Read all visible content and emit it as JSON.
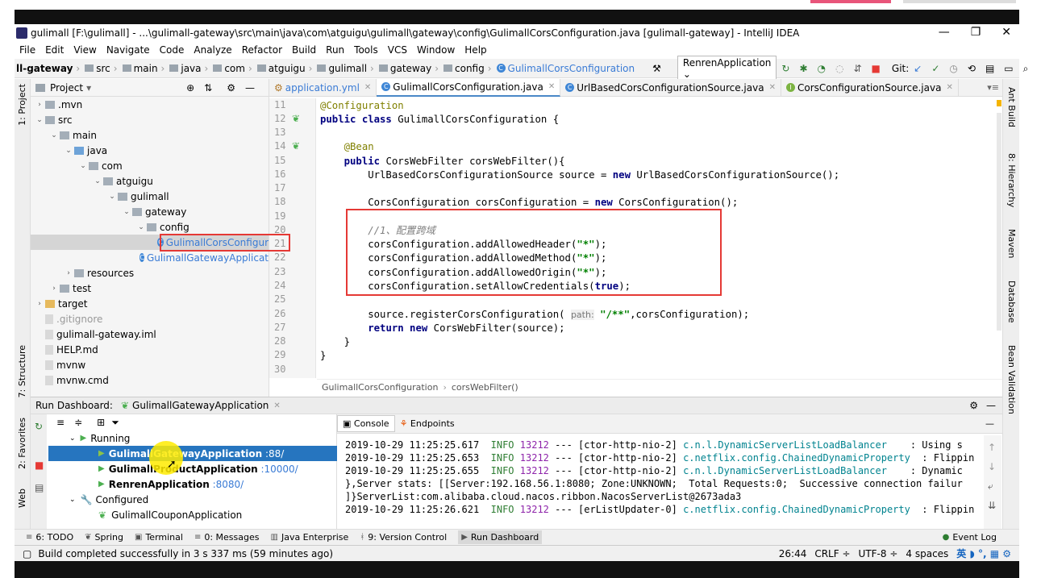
{
  "window": {
    "title": "gulimall [F:\\gulimall] - ...\\gulimall-gateway\\src\\main\\java\\com\\atguigu\\gulimall\\gateway\\config\\GulimallCorsConfiguration.java [gulimall-gateway] - IntelliJ IDEA",
    "min": "—",
    "max": "❐",
    "close": "✕"
  },
  "menu": [
    "File",
    "Edit",
    "View",
    "Navigate",
    "Code",
    "Analyze",
    "Refactor",
    "Build",
    "Run",
    "Tools",
    "VCS",
    "Window",
    "Help"
  ],
  "breadcrumb": {
    "items": [
      "ll-gateway",
      "src",
      "main",
      "java",
      "com",
      "atguigu",
      "gulimall",
      "gateway",
      "config"
    ],
    "class": "GulimallCorsConfiguration"
  },
  "toolbar": {
    "run_config": "RenrenApplication",
    "git_label": "Git:"
  },
  "left_strip": {
    "project": "1: Project",
    "structure": "7: Structure",
    "favorites": "2: Favorites",
    "web": "Web"
  },
  "right_strip": {
    "ant": "Ant Build",
    "hierarchy": "8: Hierarchy",
    "maven": "Maven",
    "database": "Database",
    "bean": "Bean Validation"
  },
  "project": {
    "header": "Project",
    "tree": [
      {
        "label": ".mvn",
        "indent": 0,
        "arrow": "›",
        "icon": "folder"
      },
      {
        "label": "src",
        "indent": 0,
        "arrow": "⌄",
        "icon": "folder"
      },
      {
        "label": "main",
        "indent": 1,
        "arrow": "⌄",
        "icon": "folder"
      },
      {
        "label": "java",
        "indent": 2,
        "arrow": "⌄",
        "icon": "folder-blue"
      },
      {
        "label": "com",
        "indent": 3,
        "arrow": "⌄",
        "icon": "folder"
      },
      {
        "label": "atguigu",
        "indent": 4,
        "arrow": "⌄",
        "icon": "folder"
      },
      {
        "label": "gulimall",
        "indent": 5,
        "arrow": "⌄",
        "icon": "folder"
      },
      {
        "label": "gateway",
        "indent": 6,
        "arrow": "⌄",
        "icon": "folder"
      },
      {
        "label": "config",
        "indent": 7,
        "arrow": "⌄",
        "icon": "folder"
      },
      {
        "label": "GulimallCorsConfigur",
        "indent": 8,
        "arrow": "",
        "icon": "class"
      },
      {
        "label": "GulimallGatewayApplicat",
        "indent": 7,
        "arrow": "",
        "icon": "class"
      },
      {
        "label": "resources",
        "indent": 2,
        "arrow": "›",
        "icon": "folder"
      },
      {
        "label": "test",
        "indent": 1,
        "arrow": "›",
        "icon": "folder"
      },
      {
        "label": "target",
        "indent": 0,
        "arrow": "›",
        "icon": "folder-yellow"
      },
      {
        "label": ".gitignore",
        "indent": 0,
        "arrow": "",
        "icon": "file"
      },
      {
        "label": "gulimall-gateway.iml",
        "indent": 0,
        "arrow": "",
        "icon": "file"
      },
      {
        "label": "HELP.md",
        "indent": 0,
        "arrow": "",
        "icon": "file"
      },
      {
        "label": "mvnw",
        "indent": 0,
        "arrow": "",
        "icon": "file"
      },
      {
        "label": "mvnw.cmd",
        "indent": 0,
        "arrow": "",
        "icon": "file"
      }
    ]
  },
  "tabs": [
    {
      "label": "application.yml",
      "active": false
    },
    {
      "label": "GulimallCorsConfiguration.java",
      "active": true
    },
    {
      "label": "UrlBasedCorsConfigurationSource.java",
      "active": false
    },
    {
      "label": "CorsConfigurationSource.java",
      "active": false
    }
  ],
  "code": {
    "line_numbers": [
      "11",
      "12",
      "13",
      "14",
      "15",
      "16",
      "17",
      "18",
      "19",
      "20",
      "21",
      "22",
      "23",
      "24",
      "25",
      "26",
      "27",
      "28",
      "29",
      "30"
    ],
    "editor_breadcrumb": [
      "GulimallCorsConfiguration",
      "corsWebFilter()"
    ],
    "hint_label": "path:"
  },
  "run": {
    "title": "Run Dashboard:",
    "app_tab": "GulimallGatewayApplication",
    "running_label": "Running",
    "configured_label": "Configured",
    "apps": [
      {
        "name": "GulimallGatewayApplication",
        "port": ":88/",
        "selected": true
      },
      {
        "name": "GulimallProductApplication",
        "port": ":10000/",
        "selected": false
      },
      {
        "name": "RenrenApplication",
        "port": ":8080/",
        "selected": false
      }
    ],
    "configured_app": "GulimallCouponApplication",
    "console_tab": "Console",
    "endpoints_tab": "Endpoints"
  },
  "console": [
    {
      "ts": "2019-10-29 11:25:25.617",
      "level": "INFO",
      "pid": "13212",
      "thread": "--- [ctor-http-nio-2]",
      "logger": "c.n.l.DynamicServerListLoadBalancer",
      "msg": "    : Using s"
    },
    {
      "ts": "2019-10-29 11:25:25.653",
      "level": "INFO",
      "pid": "13212",
      "thread": "--- [ctor-http-nio-2]",
      "logger": "c.netflix.config.ChainedDynamicProperty",
      "msg": "  : Flippin"
    },
    {
      "ts": "2019-10-29 11:25:25.655",
      "level": "INFO",
      "pid": "13212",
      "thread": "--- [ctor-http-nio-2]",
      "logger": "c.n.l.DynamicServerListLoadBalancer",
      "msg": "    : Dynamic"
    },
    {
      "raw": "},Server stats: [[Server:192.168.56.1:8080; Zone:UNKNOWN;  Total Requests:0;  Successive connection failur"
    },
    {
      "raw": "]}ServerList:com.alibaba.cloud.nacos.ribbon.NacosServerList@2673ada3"
    },
    {
      "ts": "2019-10-29 11:25:26.621",
      "level": "INFO",
      "pid": "13212",
      "thread": "--- [erListUpdater-0]",
      "logger": "c.netflix.config.ChainedDynamicProperty",
      "msg": "  : Flippin"
    }
  ],
  "tool_windows": [
    {
      "label": "6: TODO",
      "icon": "≡"
    },
    {
      "label": "Spring",
      "icon": "❦"
    },
    {
      "label": "Terminal",
      "icon": "▣"
    },
    {
      "label": "0: Messages",
      "icon": "≡"
    },
    {
      "label": "Java Enterprise",
      "icon": "▥"
    },
    {
      "label": "9: Version Control",
      "icon": "ᚼ"
    },
    {
      "label": "Run Dashboard",
      "icon": "▶"
    }
  ],
  "event_log": "Event Log",
  "status": {
    "message": "Build completed successfully in 3 s 337 ms (59 minutes ago)",
    "position": "26:44",
    "line_sep": "CRLF ÷",
    "encoding": "UTF-8 ÷",
    "indent": "4 spaces",
    "ime": "英"
  },
  "colors": {
    "accent": "#2675bf",
    "redbox": "#e53935",
    "keyword": "#000080",
    "string": "#008000"
  }
}
